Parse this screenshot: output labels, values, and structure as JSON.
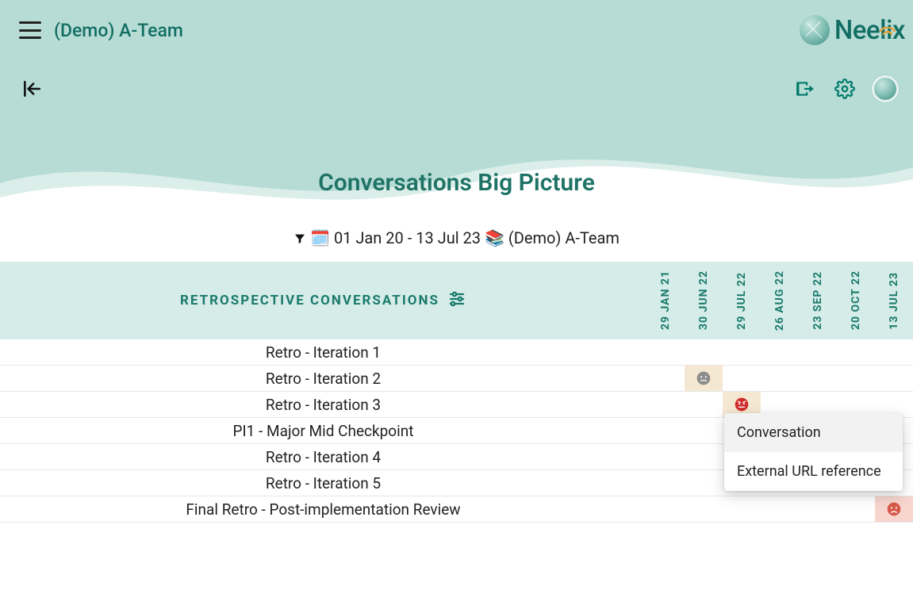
{
  "header": {
    "team_name": "(Demo) A-Team",
    "brand": "Neelix"
  },
  "page_title": "Conversations Big Picture",
  "filter": {
    "date_range": "01 Jan 20 - 13 Jul 23",
    "scope": "(Demo) A-Team"
  },
  "table": {
    "header_label": "RETROSPECTIVE CONVERSATIONS",
    "dates": [
      "29 JAN 21",
      "30 JUN 22",
      "29 JUL 22",
      "26 AUG 22",
      "23 SEP 22",
      "20 OCT 22",
      "13 JUL 23"
    ],
    "rows": [
      {
        "label": "Retro - Iteration 1",
        "marks": {}
      },
      {
        "label": "Retro - Iteration 2",
        "marks": {
          "1": "neutral"
        }
      },
      {
        "label": "Retro - Iteration 3",
        "marks": {
          "2": "angry"
        }
      },
      {
        "label": "PI1 - Major Mid Checkpoint",
        "marks": {}
      },
      {
        "label": "Retro - Iteration 4",
        "marks": {}
      },
      {
        "label": "Retro - Iteration 5",
        "marks": {}
      },
      {
        "label": "Final Retro - Post-implementation Review",
        "marks": {
          "6": "sad"
        }
      }
    ]
  },
  "popup": {
    "items": [
      "Conversation",
      "External URL reference"
    ],
    "highlight_index": 0
  }
}
